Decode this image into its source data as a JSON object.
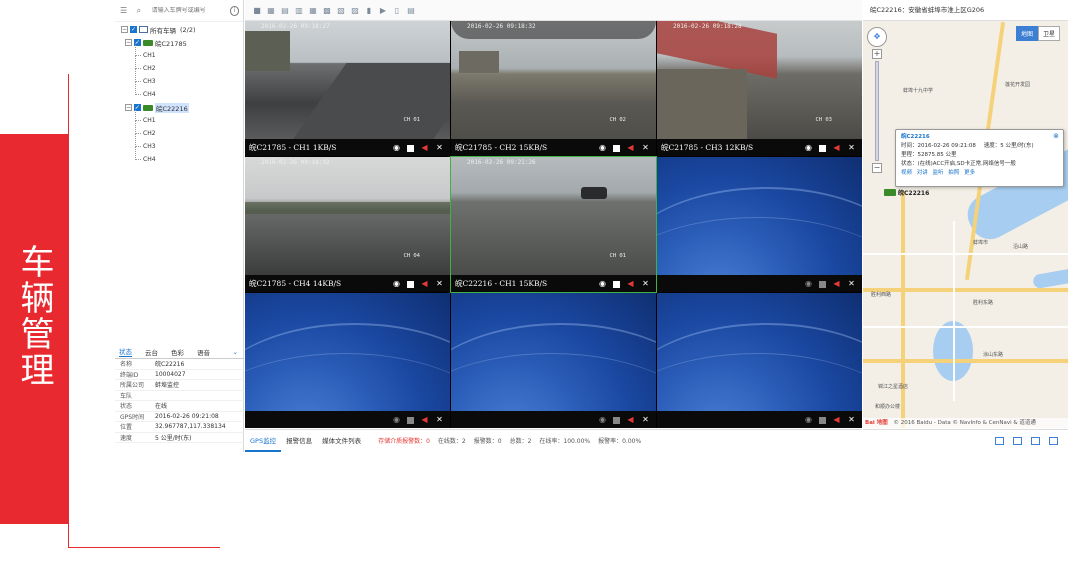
{
  "banner": {
    "title": "车辆管理"
  },
  "left_panel": {
    "search_placeholder": "请输入车牌号或编号",
    "tree": {
      "root_label": "所有车辆",
      "root_count": "(2/2)",
      "vehicles": [
        {
          "label": "皖C21785",
          "channels": [
            "CH1",
            "CH2",
            "CH3",
            "CH4"
          ]
        },
        {
          "label": "皖C22216",
          "channels": [
            "CH1",
            "CH2",
            "CH3",
            "CH4"
          ]
        }
      ]
    },
    "status_tabs": [
      "状态",
      "云台",
      "色彩",
      "语音"
    ],
    "status_fields": [
      {
        "key": "名称",
        "value": "皖C22216"
      },
      {
        "key": "终端ID",
        "value": "10004027"
      },
      {
        "key": "所属公司",
        "value": "蚌埠监控"
      },
      {
        "key": "车队",
        "value": ""
      },
      {
        "key": "状态",
        "value": "在线"
      },
      {
        "key": "GPS时间",
        "value": "2016-02-26 09:21:08"
      },
      {
        "key": "位置",
        "value": "32.967787,117.338134"
      },
      {
        "key": "速度",
        "value": "5 公里/时(东)"
      }
    ]
  },
  "toolbar": {
    "icons": [
      "layout-1-icon",
      "layout-4-icon",
      "layout-6-icon",
      "layout-8-icon",
      "layout-9-icon",
      "layout-16-icon",
      "layout-25-icon",
      "layout-36-icon",
      "stop-all-icon",
      "play-all-icon",
      "close-all-icon",
      "settings-icon"
    ]
  },
  "video_cells": [
    {
      "label": "皖C21785 - CH1 1KB/S",
      "osd": "2016-02-26 09:18:27",
      "osd_ch": "CH 01",
      "active": true
    },
    {
      "label": "皖C21785 - CH2 15KB/S",
      "osd": "2016-02-26 09:18:32",
      "osd_ch": "CH 02",
      "active": true
    },
    {
      "label": "皖C21785 - CH3 12KB/S",
      "osd": "2016-02-26 09:18:28",
      "osd_ch": "CH 03",
      "active": true
    },
    {
      "label": "皖C21785 - CH4 14KB/S",
      "osd": "2016-02-26 09:18:32",
      "osd_ch": "CH 04",
      "active": true
    },
    {
      "label": "皖C22216 - CH1 15KB/S",
      "osd": "2016-02-26 09:21:26",
      "osd_ch": "CH 01",
      "active": true
    },
    {
      "label": "",
      "osd": "",
      "osd_ch": "",
      "active": false
    },
    {
      "label": "",
      "osd": "",
      "osd_ch": "",
      "active": false
    },
    {
      "label": "",
      "osd": "",
      "osd_ch": "",
      "active": false
    },
    {
      "label": "",
      "osd": "",
      "osd_ch": "",
      "active": false
    }
  ],
  "bottom_tabs": {
    "tabs": [
      "GPS监控",
      "报警信息",
      "媒体文件列表"
    ],
    "stats": {
      "unhandled_alarms": "存储介质报警数：0",
      "online": "在线数：2",
      "offline": "报警数：0",
      "total": "总数：2",
      "online_rate": "在线率：100.00%",
      "alarm_rate": "报警率：0.00%"
    }
  },
  "map": {
    "header": "皖C22216：安徽省蚌埠市淮上区G206",
    "map_type": [
      "地图",
      "卫星"
    ],
    "popup": {
      "title": "皖C22216",
      "time_label": "时间：",
      "time": "2016-02-26 09:21:08",
      "speed_label": "速度：",
      "speed": "5 公里/时(东)",
      "mileage_label": "里程：",
      "mileage": "52875.85 公里",
      "state_label": "状态：",
      "state": "(在线)ACC开启,SD卡正常,网络信号一般",
      "links": [
        "视频",
        "对讲",
        "监听",
        "拍照",
        "更多"
      ]
    },
    "vehicle_label": "皖C22216",
    "pois": [
      "蚌埠十九中学",
      "莲花开发园",
      "蚌埠市",
      "沿山路",
      "胜利西路",
      "胜利东路",
      "涂山东路",
      "锦江之星酒店",
      "和顺办公楼"
    ],
    "footer_logo": "Bai 地图",
    "footer_text": "© 2016 Baidu - Data © NavInfo & CenNavi & 道道通"
  },
  "colors": {
    "accent": "#1874cd",
    "banner": "#e8292f",
    "alarm": "#e53935"
  }
}
